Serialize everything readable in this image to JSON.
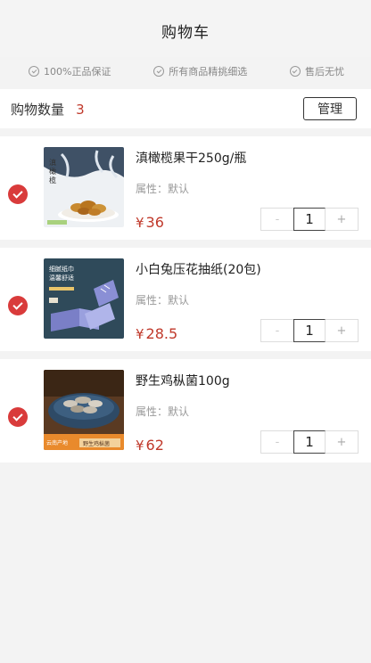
{
  "header": {
    "title": "购物车"
  },
  "guarantees": [
    {
      "label": "100%正品保证"
    },
    {
      "label": "所有商品精挑细选"
    },
    {
      "label": "售后无忧"
    }
  ],
  "cart": {
    "count_label": "购物数量",
    "count": "3",
    "manage_label": "管理"
  },
  "currency": "¥",
  "items": [
    {
      "name": "滇橄榄果干250g/瓶",
      "attr": "属性：默认",
      "price": "36",
      "qty": "1",
      "checked": true,
      "image": "olive-fruit-image",
      "image_text": [
        "滇",
        "橄",
        "榄"
      ]
    },
    {
      "name": "小白兔压花抽纸(20包)",
      "attr": "属性：默认",
      "price": "28.5",
      "qty": "1",
      "checked": true,
      "image": "tissue-box-image",
      "image_text": [
        "细腻纸巾",
        "温馨舒适"
      ]
    },
    {
      "name": "野生鸡枞菌100g",
      "attr": "属性：默认",
      "price": "62",
      "qty": "1",
      "checked": true,
      "image": "mushroom-image",
      "image_text": [
        "云南产地",
        "野生鸡枞菌"
      ]
    }
  ],
  "stepper": {
    "minus": "-",
    "plus": "+"
  },
  "colors": {
    "accent": "#d93b3b",
    "price": "#c0392b"
  }
}
